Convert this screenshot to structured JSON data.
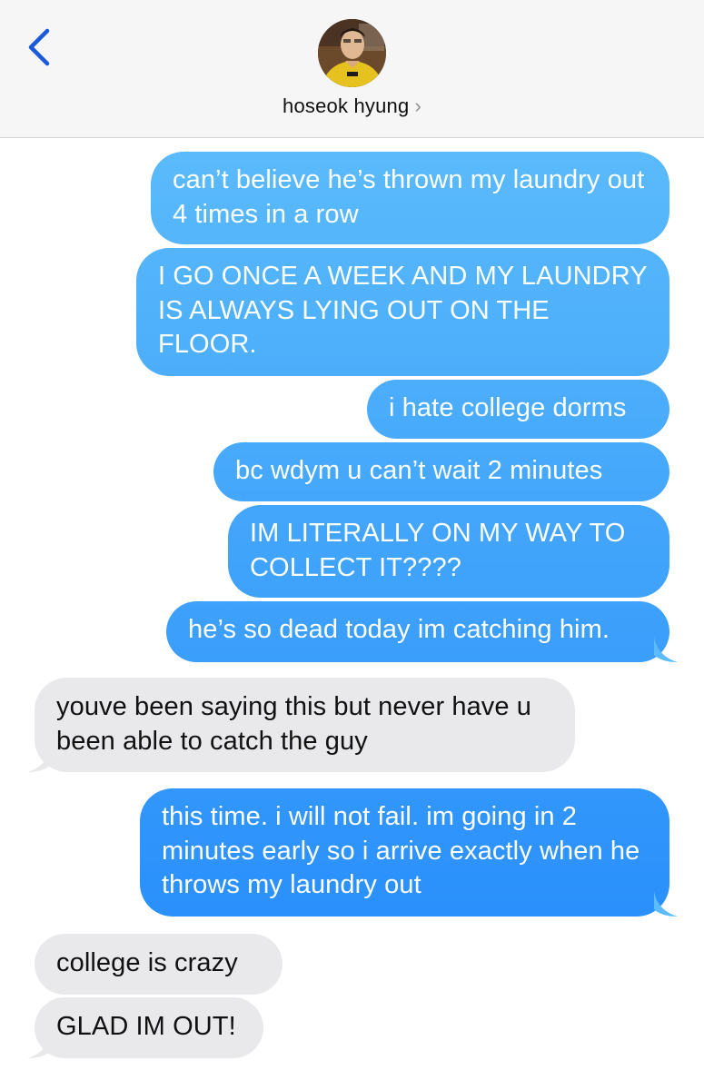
{
  "header": {
    "contact_name": "hoseok hyung",
    "chevron": "›",
    "back_icon": "chevron-left-icon"
  },
  "colors": {
    "outgoing_top": "#5bbbfb",
    "outgoing_bottom": "#1f86fb",
    "incoming": "#e9e9eb",
    "back_arrow": "#1a5ad9"
  },
  "messages": [
    {
      "from": "me",
      "text": "can’t believe he’s thrown my laundry out 4 times in a row"
    },
    {
      "from": "me",
      "text": "I GO ONCE A WEEK AND MY LAUNDRY IS ALWAYS LYING OUT ON THE FLOOR."
    },
    {
      "from": "me",
      "text": "i hate college dorms"
    },
    {
      "from": "me",
      "text": "bc wdym u can’t wait 2 minutes"
    },
    {
      "from": "me",
      "text": "IM LITERALLY ON MY WAY TO COLLECT IT????"
    },
    {
      "from": "me",
      "text": "he’s so dead today im catching him."
    },
    {
      "from": "them",
      "text": "youve been saying this but never have u been able to catch the guy"
    },
    {
      "from": "me",
      "text": "this time. i will not fail. im going in 2 minutes early so i arrive exactly when he throws my laundry out"
    },
    {
      "from": "them",
      "text": "college is crazy"
    },
    {
      "from": "them",
      "text": "GLAD IM OUT!"
    }
  ]
}
